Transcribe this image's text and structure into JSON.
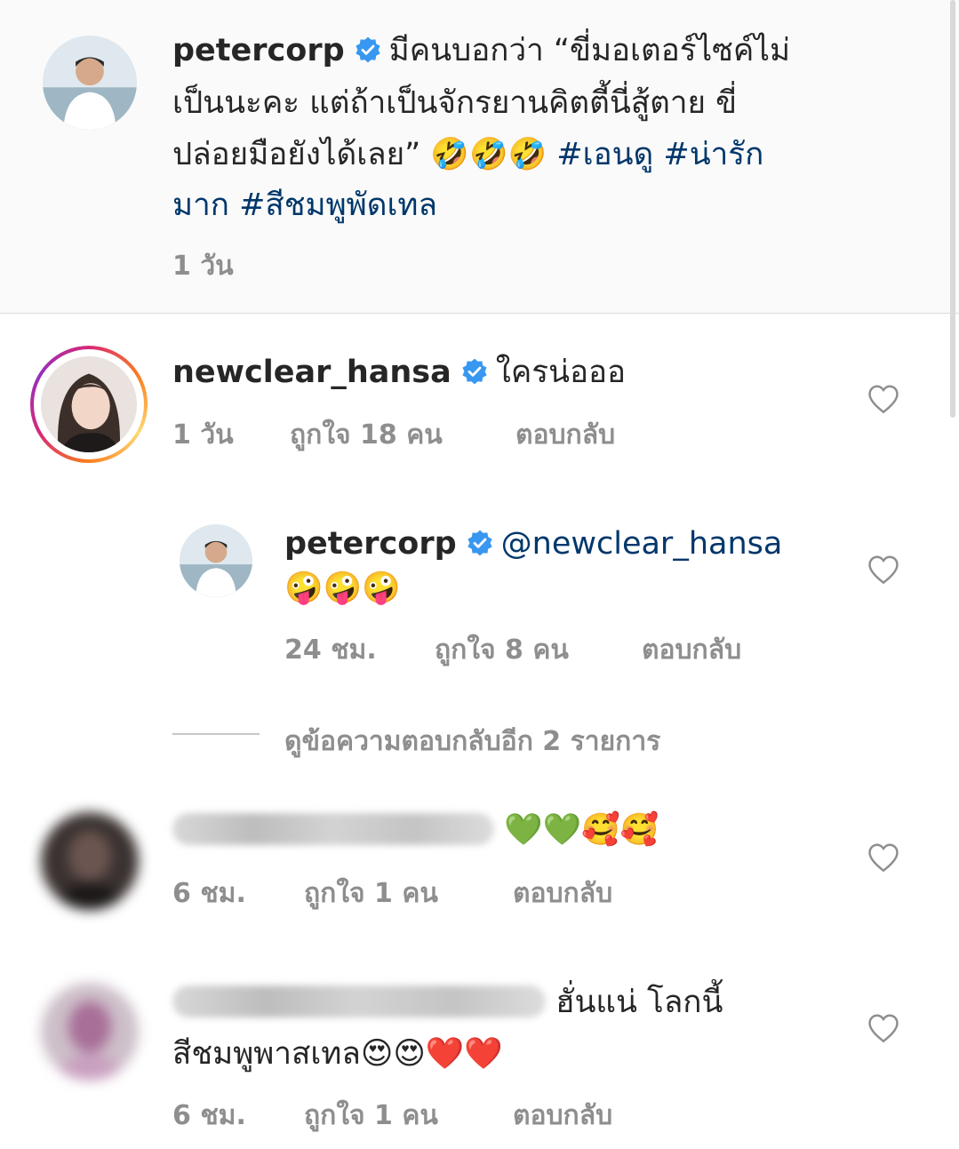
{
  "caption": {
    "username": "petercorp",
    "text_line1": "มีคนบอกว่า “ขี่มอเตอร์ไซค์ไม่",
    "text_line2": "เป็นนะคะ แต่ถ้าเป็นจักรยานคิตตี้นี่สู้ตาย ขี่",
    "text_line3": "ปล่อยมือยังได้เลย”",
    "emojis_line3": "🤣🤣🤣",
    "hashtag1": "#เอนดู",
    "hashtag2": "#น่ารัก",
    "hashtag2_cont": "มาก",
    "hashtag3": "#สีชมพูพัดเทล",
    "time": "1 วัน"
  },
  "comments": [
    {
      "username": "newclear_hansa",
      "text": "ใครน่อออ",
      "time": "1 วัน",
      "likes": "ถูกใจ 18 คน",
      "reply": "ตอบกลับ"
    },
    {
      "username": "petercorp",
      "mention": "@newclear_hansa",
      "emojis": "🤪🤪🤪",
      "time": "24 ชม.",
      "likes": "ถูกใจ 8 คน",
      "reply": "ตอบกลับ"
    },
    {
      "emojis": "💚💚🥰🥰",
      "time": "6 ชม.",
      "likes": "ถูกใจ 1 คน",
      "reply": "ตอบกลับ"
    },
    {
      "text_line1": "ฮั่นแน่ โลกนี้",
      "text_line2": "สีชมพูพาสเทล",
      "emojis": "😍😍❤️❤️",
      "time": "6 ชม.",
      "likes": "ถูกใจ 1 คน",
      "reply": "ตอบกลับ"
    }
  ],
  "view_replies": "ดูข้อความตอบกลับอีก 2 รายการ",
  "colors": {
    "verified": "#3897f0",
    "hashtag": "#00376b",
    "meta": "#8e8e8e",
    "text": "#262626"
  },
  "icons": [
    "verified-badge-icon",
    "heart-outline-icon"
  ]
}
